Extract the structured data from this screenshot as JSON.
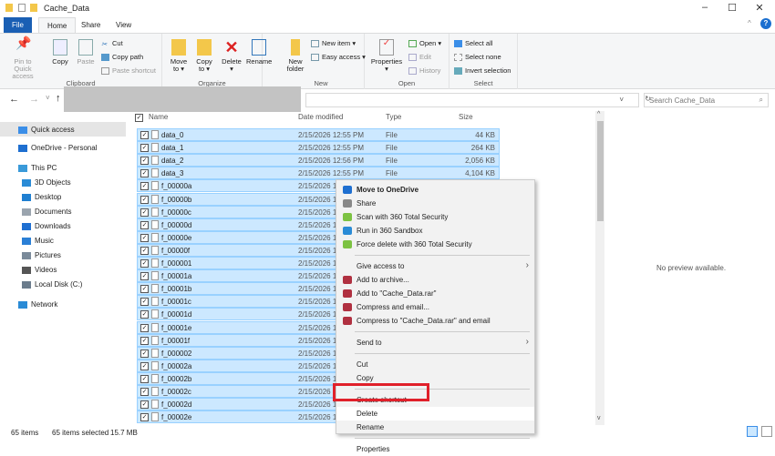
{
  "window": {
    "title": "Cache_Data",
    "minimize": "–",
    "maximize": "☐",
    "close": "✕",
    "help": "?"
  },
  "tabs": [
    "File",
    "Home",
    "Share",
    "View"
  ],
  "ribbon": {
    "clipboard": {
      "label": "Clipboard",
      "pin": "Pin to Quick access",
      "copy": "Copy",
      "paste": "Paste",
      "cut": "Cut",
      "copy_path": "Copy path",
      "paste_shortcut": "Paste shortcut"
    },
    "organize": {
      "label": "Organize",
      "move": "Move to ▾",
      "copy": "Copy to ▾",
      "delete": "Delete ▾",
      "rename": "Rename"
    },
    "new": {
      "label": "New",
      "folder": "New folder",
      "item": "New item ▾",
      "easy": "Easy access ▾"
    },
    "open": {
      "label": "Open",
      "properties": "Properties ▾",
      "open": "Open ▾",
      "edit": "Edit",
      "history": "History"
    },
    "select": {
      "label": "Select",
      "all": "Select all",
      "none": "Select none",
      "invert": "Invert selection"
    }
  },
  "address": {
    "back": "←",
    "forward": "→",
    "recent": "˅",
    "up": "↑",
    "dropdown": "˅",
    "refresh": "↻",
    "search_placeholder": "Search Cache_Data",
    "search_icon": "⌕"
  },
  "nav": [
    {
      "label": "Quick access",
      "color": "#3b8ee8",
      "indent": 0,
      "selected": true
    },
    {
      "label": "OneDrive - Personal",
      "color": "#1e6fd0",
      "indent": 0
    },
    {
      "label": "This PC",
      "color": "#3a9ad9",
      "indent": 0
    },
    {
      "label": "3D Objects",
      "color": "#2a8bd6",
      "indent": 1
    },
    {
      "label": "Desktop",
      "color": "#1f7fd1",
      "indent": 1
    },
    {
      "label": "Documents",
      "color": "#9aa4ae",
      "indent": 1
    },
    {
      "label": "Downloads",
      "color": "#1f6fd1",
      "indent": 1
    },
    {
      "label": "Music",
      "color": "#2a7fd6",
      "indent": 1
    },
    {
      "label": "Pictures",
      "color": "#7a8a9a",
      "indent": 1
    },
    {
      "label": "Videos",
      "color": "#555",
      "indent": 1
    },
    {
      "label": "Local Disk (C:)",
      "color": "#6b7c8c",
      "indent": 1
    },
    {
      "label": "Network",
      "color": "#2a8bd6",
      "indent": 0
    }
  ],
  "columns": {
    "name": "Name",
    "date": "Date modified",
    "type": "Type",
    "size": "Size"
  },
  "files": [
    {
      "name": "data_0",
      "date": "2/15/2026 12:55 PM",
      "type": "File",
      "size": "44 KB"
    },
    {
      "name": "data_1",
      "date": "2/15/2026 12:55 PM",
      "type": "File",
      "size": "264 KB"
    },
    {
      "name": "data_2",
      "date": "2/15/2026 12:56 PM",
      "type": "File",
      "size": "2,056 KB"
    },
    {
      "name": "data_3",
      "date": "2/15/2026 12:55 PM",
      "type": "File",
      "size": "4,104 KB"
    },
    {
      "name": "f_00000a",
      "date": "2/15/2026 1"
    },
    {
      "name": "f_00000b",
      "date": "2/15/2026 1"
    },
    {
      "name": "f_00000c",
      "date": "2/15/2026 1"
    },
    {
      "name": "f_00000d",
      "date": "2/15/2026 1"
    },
    {
      "name": "f_00000e",
      "date": "2/15/2026 1"
    },
    {
      "name": "f_00000f",
      "date": "2/15/2026 1"
    },
    {
      "name": "f_000001",
      "date": "2/15/2026 1"
    },
    {
      "name": "f_00001a",
      "date": "2/15/2026 1"
    },
    {
      "name": "f_00001b",
      "date": "2/15/2026 1"
    },
    {
      "name": "f_00001c",
      "date": "2/15/2026 1"
    },
    {
      "name": "f_00001d",
      "date": "2/15/2026 1"
    },
    {
      "name": "f_00001e",
      "date": "2/15/2026 1"
    },
    {
      "name": "f_00001f",
      "date": "2/15/2026 1"
    },
    {
      "name": "f_000002",
      "date": "2/15/2026 1"
    },
    {
      "name": "f_00002a",
      "date": "2/15/2026 1"
    },
    {
      "name": "f_00002b",
      "date": "2/15/2026 1"
    },
    {
      "name": "f_00002c",
      "date": "2/15/2026 1"
    },
    {
      "name": "f_00002d",
      "date": "2/15/2026 1"
    },
    {
      "name": "f_00002e",
      "date": "2/15/2026 1"
    }
  ],
  "preview": "No preview available.",
  "status": {
    "count": "65 items",
    "selected": "65 items selected",
    "size": "15.7 MB"
  },
  "context_menu": [
    {
      "label": "Move to OneDrive",
      "bold": true,
      "icon": "#1e6fd0"
    },
    {
      "label": "Share",
      "icon": "#888"
    },
    {
      "label": "Scan with 360 Total Security",
      "icon": "#7cc242"
    },
    {
      "label": "Run in 360 Sandbox",
      "icon": "#2a8bd6"
    },
    {
      "label": "Force delete with 360 Total Security",
      "icon": "#7cc242"
    },
    {
      "sep": true
    },
    {
      "label": "Give access to",
      "sub": true
    },
    {
      "label": "Add to archive...",
      "icon": "#b03040"
    },
    {
      "label": "Add to \"Cache_Data.rar\"",
      "icon": "#b03040"
    },
    {
      "label": "Compress and email...",
      "icon": "#b03040"
    },
    {
      "label": "Compress to \"Cache_Data.rar\" and email",
      "icon": "#b03040"
    },
    {
      "sep": true
    },
    {
      "label": "Send to",
      "sub": true
    },
    {
      "sep": true
    },
    {
      "label": "Cut"
    },
    {
      "label": "Copy"
    },
    {
      "sep": true
    },
    {
      "label": "Create shortcut"
    },
    {
      "label": "Delete",
      "hot": true
    },
    {
      "label": "Rename"
    },
    {
      "sep": true
    },
    {
      "label": "Properties"
    }
  ],
  "submenu_arrow": "›"
}
